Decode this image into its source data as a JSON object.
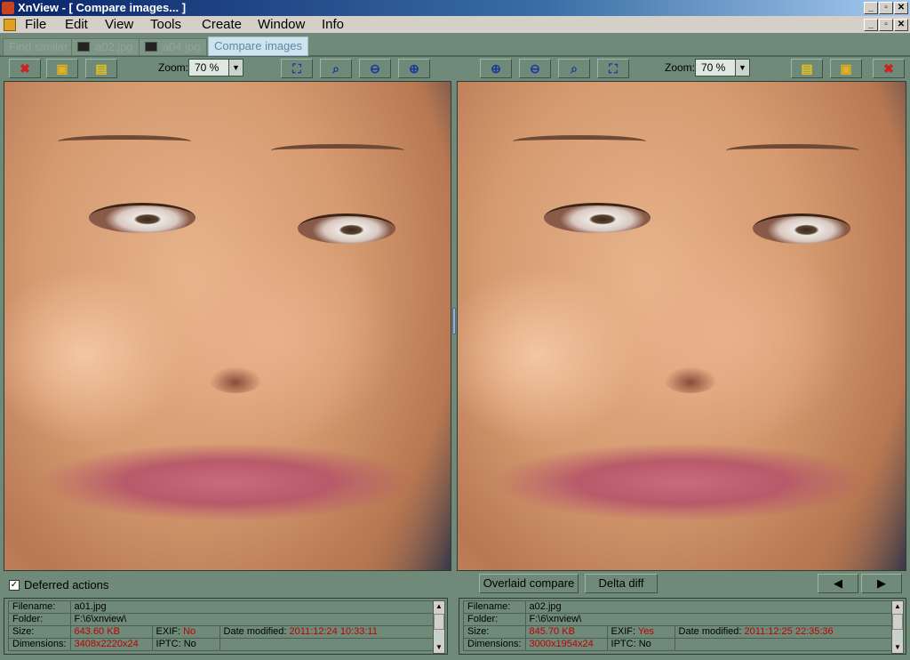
{
  "window": {
    "title": "XnView - [  Compare images... ]",
    "min_glyph": "_",
    "max_glyph": "▫",
    "close_glyph": "✕"
  },
  "menu": [
    "File",
    "Edit",
    "View",
    "Tools",
    "Create",
    "Window",
    "Info"
  ],
  "tabs": [
    {
      "label": "Find similar"
    },
    {
      "label": "a02.jpg"
    },
    {
      "label": "a04.jpg"
    },
    {
      "label": "Compare images"
    }
  ],
  "left_toolbar": {
    "zoom_label": "Zoom:",
    "zoom_value": "70 %"
  },
  "right_toolbar": {
    "zoom_label": "Zoom:",
    "zoom_value": "70 %"
  },
  "icons": {
    "close": "✖",
    "open": "▣",
    "save": "▤",
    "fit": "⛶",
    "actual": "⌕",
    "zoom_out": "⊖",
    "zoom_in": "⊕",
    "prev": "◀",
    "next": "▶",
    "check": "✓",
    "scroll_up": "▲",
    "scroll_down": "▼",
    "dropdown": "▼"
  },
  "bottom": {
    "deferred_label": "Deferred actions",
    "overlaid_label": "Overlaid compare",
    "delta_label": "Delta diff"
  },
  "info_labels": {
    "filename": "Filename:",
    "folder": "Folder:",
    "size": "Size:",
    "dimensions": "Dimensions:",
    "exif": "EXIF:",
    "iptc": "IPTC:",
    "date": "Date modified:"
  },
  "left_info": {
    "filename": "a01.jpg",
    "folder": "F:\\6\\xnview\\",
    "size": "643.60 KB",
    "exif": "No",
    "date": "2011:12:24 10:33:11",
    "dimensions": "3408x2220x24",
    "iptc": "No"
  },
  "right_info": {
    "filename": "a02.jpg",
    "folder": "F:\\6\\xnview\\",
    "size": "845.70 KB",
    "exif": "Yes",
    "date": "2011:12:25 22:35:36",
    "dimensions": "3000x1954x24",
    "iptc": "No"
  },
  "colors": {
    "panel": "#6f8a78",
    "highlight_value": "#c00000",
    "active_tab": "#cfe3ee"
  }
}
